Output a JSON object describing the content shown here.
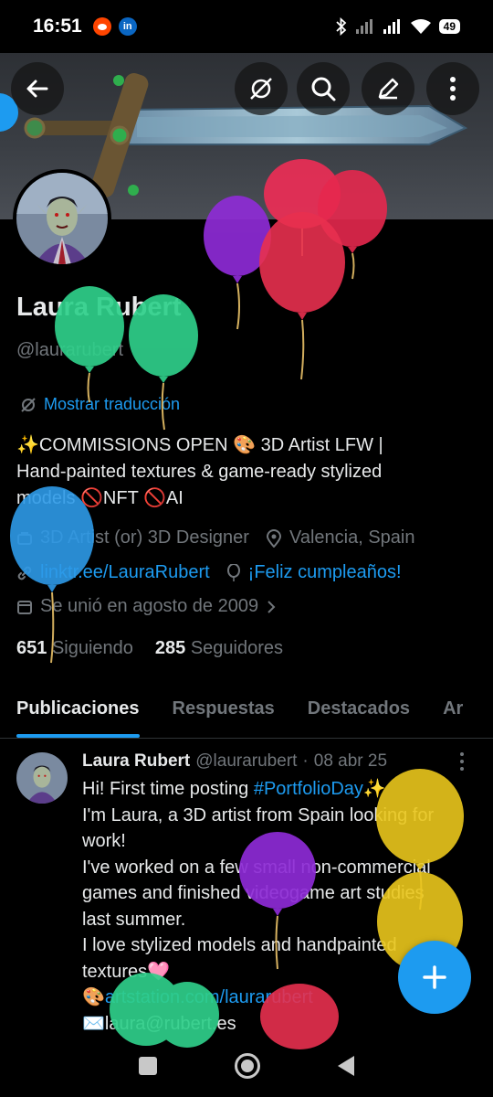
{
  "status_bar": {
    "time": "16:51",
    "linkedin_label": "in",
    "battery": "49"
  },
  "profile": {
    "name": "Laura Rubert",
    "handle": "@laurarubert",
    "translate": "Mostrar traducción",
    "bio": "✨COMMISSIONS OPEN 🎨 3D Artist LFW |\nHand-painted textures & game-ready stylized\nmodels  🚫NFT 🚫AI",
    "profession": "3D Artist (or) 3D Designer",
    "location": "Valencia, Spain",
    "website": "linktr.ee/LauraRubert",
    "birthday": "¡Feliz cumpleaños!",
    "joined": "Se unió en agosto de 2009",
    "following_count": "651",
    "following_label": "Siguiendo",
    "followers_count": "285",
    "followers_label": "Seguidores"
  },
  "tabs": [
    {
      "label": "Publicaciones",
      "active": true
    },
    {
      "label": "Respuestas",
      "active": false
    },
    {
      "label": "Destacados",
      "active": false
    },
    {
      "label": "Ar",
      "active": false
    }
  ],
  "post": {
    "author": "Laura Rubert",
    "handle": "@laurarubert",
    "sep": "·",
    "date": "08 abr 25",
    "line1_a": "Hi! First time posting ",
    "hashtag": "#PortfolioDay",
    "line1_b": "✨",
    "line2": "I'm Laura, a 3D artist from Spain looking for",
    "line3": "work!",
    "line4": "I've worked on a few small non-commercial",
    "line5": "games and finished videogame art studies",
    "line6": "last summer.",
    "line7": "I love stylized models and handpainted",
    "line8": "textures🩷",
    "line9_emoji": "🎨",
    "line9_link": "artstation.com/laurarubert",
    "line10_emoji": "✉️",
    "line10_text": "laura@rubert.es"
  },
  "colors": {
    "accent": "#1d9bf0",
    "muted": "#71767b",
    "text": "#e7e9ea",
    "background": "#000000"
  },
  "icons": {
    "back": "arrow-left-icon",
    "translate": "translate-icon",
    "search": "search-icon",
    "edit": "pencil-icon",
    "more": "more-vertical-icon",
    "compose": "plus-icon"
  }
}
